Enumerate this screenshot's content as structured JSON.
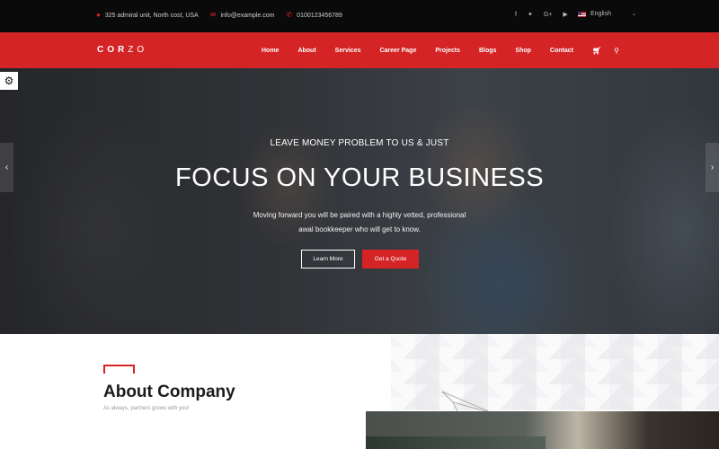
{
  "topbar": {
    "address": "325 admiral unit, North cost, USA",
    "email": "info@example.com",
    "phone": "0100123456789",
    "social": [
      "facebook",
      "twitter",
      "google-plus",
      "youtube"
    ],
    "language": "English"
  },
  "nav": {
    "logo_bold": "COR",
    "logo_light": "ZO",
    "items": [
      "Home",
      "About",
      "Services",
      "Career Page",
      "Projects",
      "Blogs",
      "Shop",
      "Contact"
    ]
  },
  "hero": {
    "subtitle": "LEAVE MONEY PROBLEM TO US & JUST",
    "title": "FOCUS ON YOUR BUSINESS",
    "description_line1": "Moving forward you will be paired with a highly vetted, professional",
    "description_line2": "awal bookkeeper who will get to know.",
    "learn_more": "Learn More",
    "get_quote": "Get a Quote"
  },
  "about": {
    "title": "About Company",
    "subtitle": "As always, partners grows with you!"
  },
  "colors": {
    "accent": "#d42426",
    "topbar_bg": "#0a0a0a"
  }
}
